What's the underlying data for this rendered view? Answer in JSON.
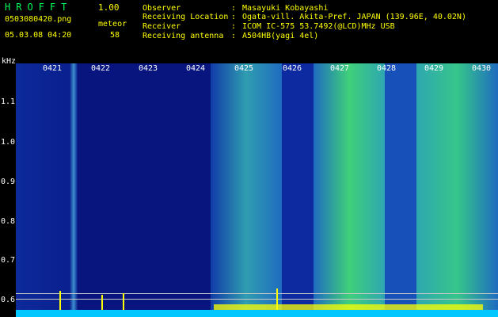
{
  "header": {
    "title": "HROFFT",
    "version": "1.00",
    "filename": "0503080420.png",
    "meteor_label": "meteor",
    "timestamp": "05.03.08 04:20",
    "meteor_count": "58"
  },
  "info": [
    {
      "key": "Observer",
      "value": "Masayuki Kobayashi"
    },
    {
      "key": "Receiving Location",
      "value": "Ogata-vill. Akita-Pref. JAPAN (139.96E, 40.02N)"
    },
    {
      "key": "Receiver",
      "value": "ICOM IC-575 53.7492(@LCD)MHz USB"
    },
    {
      "key": "Receiving antenna",
      "value": "A504HB(yagi 4el)"
    }
  ],
  "axis": {
    "y_unit": "kHz",
    "y_ticks": [
      "1.1",
      "1.0",
      "0.9",
      "0.8",
      "0.7",
      "0.6"
    ],
    "minute_labels": [
      "0421",
      "0422",
      "0423",
      "0424",
      "0425",
      "0426",
      "0427",
      "0428",
      "0429",
      "0430"
    ]
  },
  "colors": {
    "background": "#000000",
    "info_text": "#ffff00",
    "title_text": "#00ff5a",
    "axis_text": "#ffffff",
    "spectrum_low": "#0a1a8a",
    "spectrum_high": "#3fd07a"
  }
}
